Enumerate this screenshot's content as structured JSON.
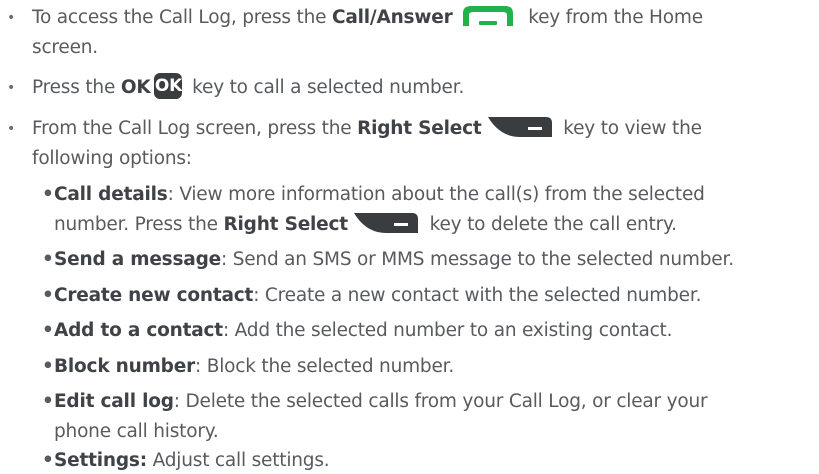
{
  "bullets": [
    {
      "pre": "To access the Call Log, press the ",
      "key_label": "Call/Answer",
      "key_icon": "call-answer-key-icon",
      "post": " key from the Home",
      "line2": "screen."
    },
    {
      "pre": "Press the ",
      "key_label": "OK",
      "key_icon_text": "OK",
      "post": " key to call a selected number."
    },
    {
      "pre": "From the Call Log screen, press the ",
      "key_label": "Right Select",
      "key_icon": "right-select-key-icon",
      "post": " key to view the",
      "line2": "following options:"
    }
  ],
  "options": [
    {
      "title": "Call details",
      "text": ": View more information about the call(s) from the selected",
      "line2_pre": "number. Press the ",
      "line2_key": "Right Select",
      "line2_post": " key to delete the call entry."
    },
    {
      "title": "Send a message",
      "text": ": Send an SMS or MMS message to the selected number."
    },
    {
      "title": "Create new contact",
      "text": ": Create a new contact with the selected number."
    },
    {
      "title": "Add to a contact",
      "text": ": Add the selected number to an existing contact."
    },
    {
      "title": "Block number",
      "text": ": Block the selected number."
    },
    {
      "title": "Edit call log",
      "text": ": Delete the selected calls from your Call Log, or clear your",
      "line2": "phone call history."
    },
    {
      "title": "Settings:",
      "text": " Adjust call settings."
    }
  ],
  "colors": {
    "text": "#575a5e",
    "bold": "#3f4246",
    "call_key_green": "#22b24c",
    "key_dark": "#3a3d40"
  }
}
